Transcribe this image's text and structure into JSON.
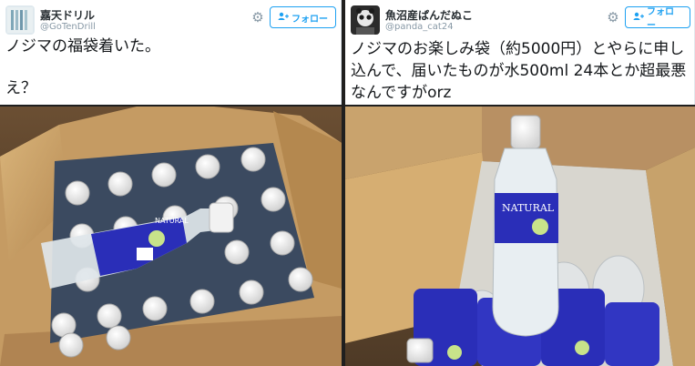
{
  "tweets": [
    {
      "display_name": "嘉天ドリル",
      "handle": "@GoTenDrill",
      "follow_label": "フォロー",
      "text": "ノジマの福袋着いた。\n\nえ？"
    },
    {
      "display_name": "魚沼産ぱんだぬこ",
      "handle": "@panda_cat24",
      "follow_label": "フォロー",
      "text": "ノジマのお楽しみ袋（約5000円）とやらに申し込んで、届いたものが水500ml 24本とか超最悪なんですがorz"
    }
  ],
  "photo_labels": {
    "bottle_label_text": "NATURAL"
  },
  "colors": {
    "link_blue": "#1da1f2",
    "meta_gray": "#8899a6",
    "cardboard": "#c49b62",
    "bottle_label": "#2a2eb8"
  }
}
